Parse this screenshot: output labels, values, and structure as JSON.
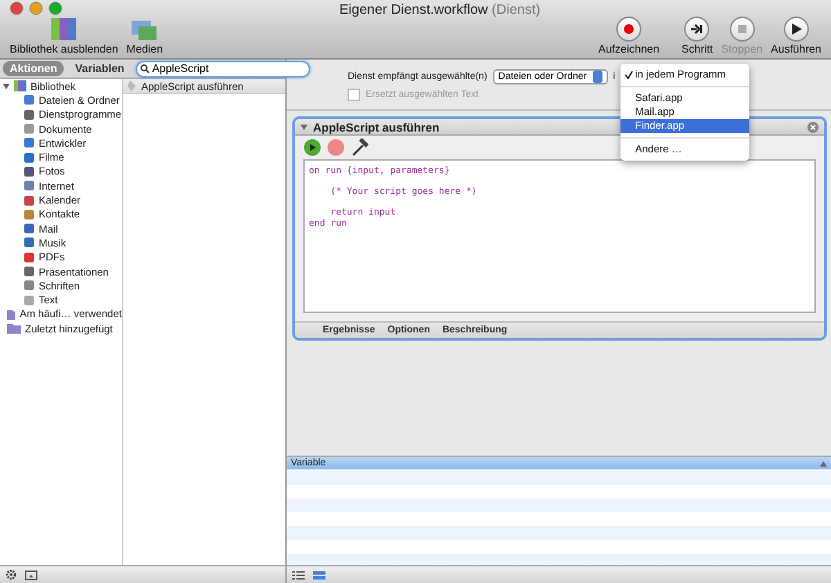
{
  "window": {
    "title": "Eigener Dienst.workflow",
    "subtitle": "(Dienst)"
  },
  "toolbar": {
    "left": [
      {
        "label": "Bibliothek ausblenden",
        "kind": "library"
      },
      {
        "label": "Medien",
        "kind": "media"
      }
    ],
    "right": [
      {
        "label": "Aufzeichnen",
        "kind": "record",
        "disabled": false
      },
      {
        "label": "Schritt",
        "kind": "step",
        "disabled": false
      },
      {
        "label": "Stoppen",
        "kind": "stop",
        "disabled": true
      },
      {
        "label": "Ausführen",
        "kind": "run",
        "disabled": false
      }
    ]
  },
  "library": {
    "tabs": [
      {
        "label": "Aktionen",
        "selected": true
      },
      {
        "label": "Variablen",
        "selected": false
      }
    ],
    "search": {
      "value": "AppleScript"
    },
    "tree": [
      {
        "label": "Bibliothek",
        "expanded": true,
        "children": [
          {
            "label": "Dateien & Ordner"
          },
          {
            "label": "Dienstprogramme"
          },
          {
            "label": "Dokumente"
          },
          {
            "label": "Entwickler"
          },
          {
            "label": "Filme"
          },
          {
            "label": "Fotos"
          },
          {
            "label": "Internet"
          },
          {
            "label": "Kalender"
          },
          {
            "label": "Kontakte"
          },
          {
            "label": "Mail"
          },
          {
            "label": "Musik"
          },
          {
            "label": "PDFs"
          },
          {
            "label": "Präsentationen"
          },
          {
            "label": "Schriften"
          },
          {
            "label": "Text"
          }
        ]
      },
      {
        "label": "Am häufi… verwendet"
      },
      {
        "label": "Zuletzt hinzugefügt"
      }
    ],
    "results": [
      "AppleScript ausführen"
    ]
  },
  "service": {
    "label": "Dienst empfängt ausgewählte(n)",
    "input_type": "Dateien oder Ordner",
    "in_label": "i",
    "checkbox": {
      "label": "Ersetzt ausgewählten Text",
      "checked": false,
      "disabled": true
    },
    "menu": [
      {
        "kind": "item",
        "label": "in jedem Programm",
        "checked": true,
        "selected": false
      },
      {
        "kind": "separator"
      },
      {
        "kind": "item",
        "label": "Safari.app",
        "checked": false,
        "selected": false
      },
      {
        "kind": "item",
        "label": "Mail.app",
        "checked": false,
        "selected": false
      },
      {
        "kind": "item",
        "label": "Finder.app",
        "checked": false,
        "selected": true
      },
      {
        "kind": "separator"
      },
      {
        "kind": "item",
        "label": "Andere …",
        "checked": false,
        "selected": false
      }
    ]
  },
  "action": {
    "title": "AppleScript ausführen",
    "code": "on run {input, parameters}\n\n    (* Your script goes here *)\n\n    return input\nend run",
    "tabs": [
      "Ergebnisse",
      "Optionen",
      "Beschreibung"
    ]
  },
  "variables": {
    "columns": [
      "Variable"
    ]
  }
}
